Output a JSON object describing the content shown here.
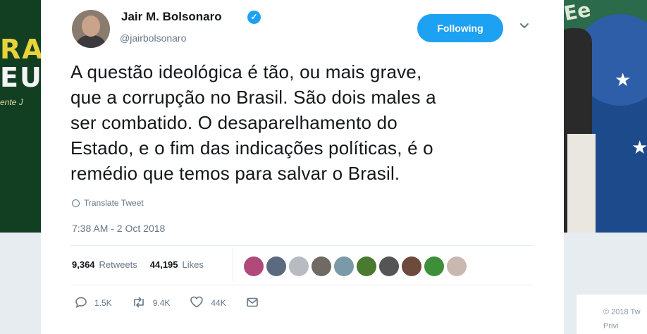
{
  "author": {
    "name": "Jair M. Bolsonaro",
    "handle": "@jairbolsonaro",
    "verified_icon": "verified-badge-icon"
  },
  "follow_button": "Following",
  "tweet": {
    "lines": [
      "A questão ideológica é tão, ou mais grave,",
      "que a corrupção no Brasil. São dois males a",
      "ser combatido. O desaparelhamento do",
      "Estado, e o fim das indicações políticas, é o",
      "remédio que temos para salvar o Brasil."
    ],
    "translate": "Translate Tweet",
    "timestamp": "7:38 AM - 2 Oct 2018"
  },
  "stats": {
    "retweets_count": "9,364",
    "retweets_label": "Retweets",
    "likes_count": "44,195",
    "likes_label": "Likes"
  },
  "likers": [
    "#b04a7a",
    "#5b6a7e",
    "#b8bcc2",
    "#6f6a63",
    "#7a9aa8",
    "#4a7a30",
    "#555555",
    "#6d4a3c",
    "#3f8f3a",
    "#c9b8b0"
  ],
  "actions": {
    "reply_count": "1.5K",
    "retweet_count": "9.4K",
    "like_count": "44K"
  },
  "background": {
    "left_banner_line1": "RAS",
    "left_banner_line2": "EUS",
    "left_banner_small": "ente J",
    "right_flag_text": "Ee",
    "footer_line1": "© 2018 Tw",
    "footer_line2": "Privi"
  },
  "colors": {
    "accent": "#1da1f2",
    "text": "#14171a",
    "muted": "#657786"
  }
}
